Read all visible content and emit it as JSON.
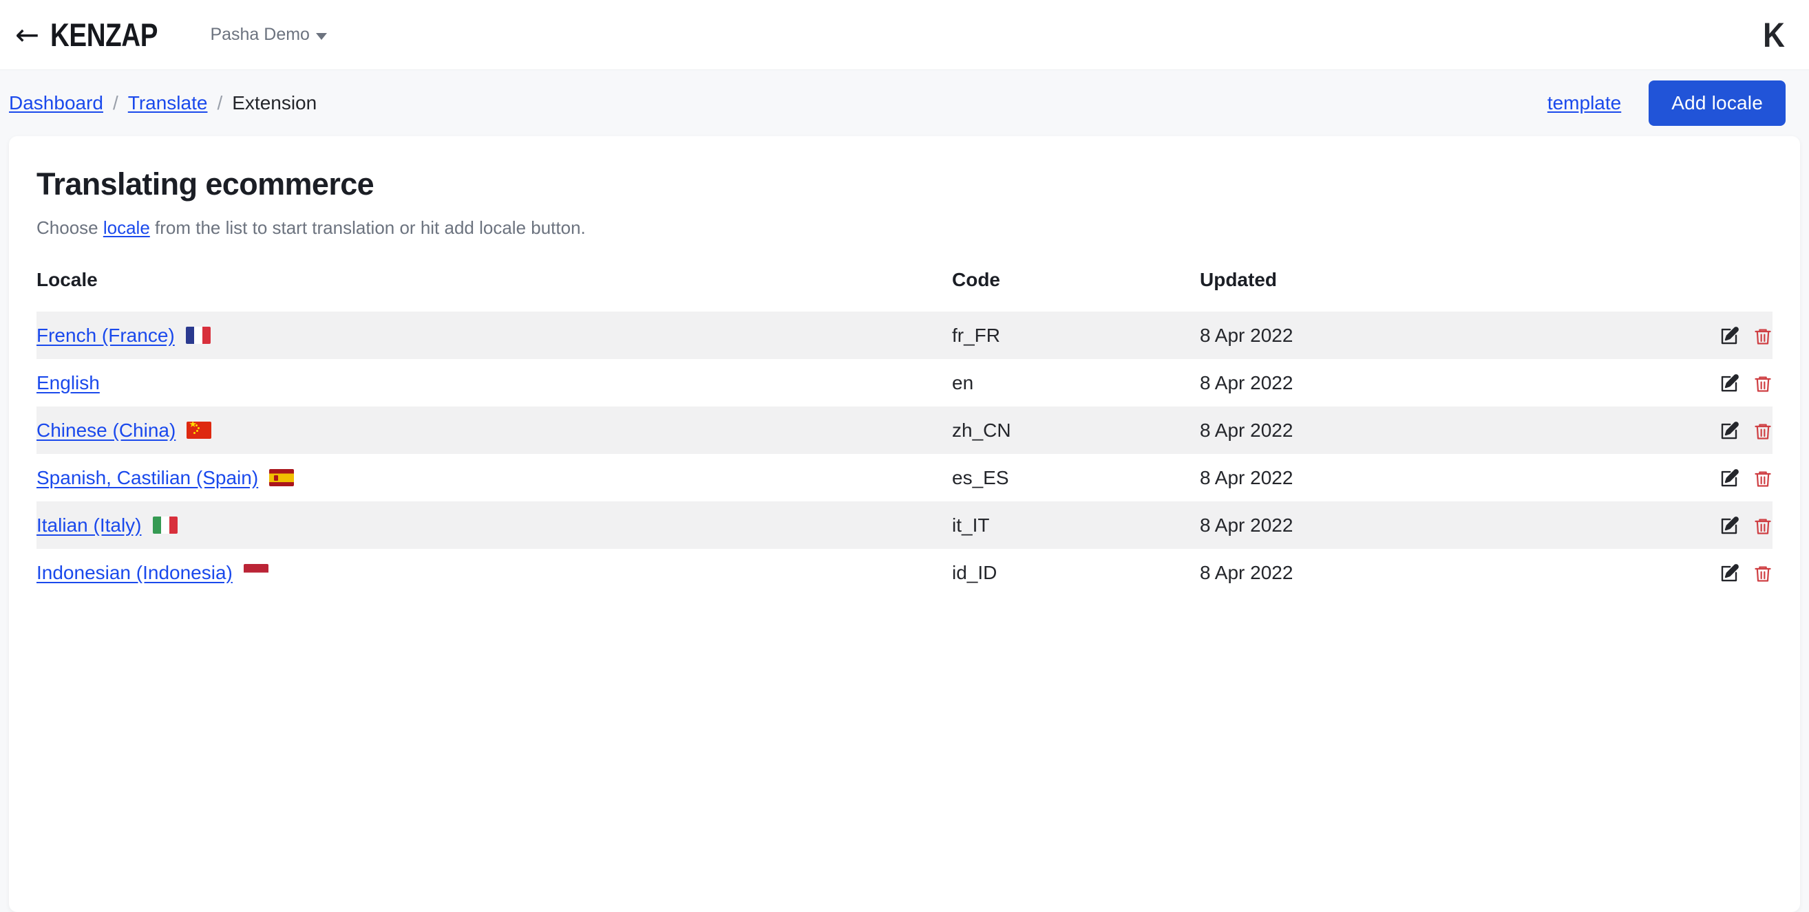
{
  "header": {
    "back_label": "←",
    "brand": "KENZAP",
    "site_selector": "Pasha Demo",
    "caret_icon": "chevron-down-icon",
    "avatar_letter": "K"
  },
  "breadcrumb": {
    "items": [
      {
        "label": "Dashboard",
        "link": true
      },
      {
        "label": "Translate",
        "link": true
      },
      {
        "label": "Extension",
        "link": false
      }
    ],
    "separator": "/",
    "template_link": "template",
    "add_locale_button": "Add locale"
  },
  "main": {
    "title": "Translating ecommerce",
    "subtitle_before": "Choose ",
    "subtitle_link": "locale",
    "subtitle_after": " from the list to start translation or hit add locale button.",
    "columns": {
      "locale": "Locale",
      "code": "Code",
      "updated": "Updated"
    },
    "rows": [
      {
        "locale": "French (France)",
        "flag": "flag-fr",
        "flag_name": "flag-france",
        "code": "fr_FR",
        "updated": "8 Apr 2022",
        "stripe": true
      },
      {
        "locale": "English",
        "flag": "",
        "flag_name": "",
        "code": "en",
        "updated": "8 Apr 2022",
        "stripe": false
      },
      {
        "locale": "Chinese (China)",
        "flag": "flag-cn",
        "flag_name": "flag-china",
        "code": "zh_CN",
        "updated": "8 Apr 2022",
        "stripe": true
      },
      {
        "locale": "Spanish, Castilian (Spain)",
        "flag": "flag-es",
        "flag_name": "flag-spain",
        "code": "es_ES",
        "updated": "8 Apr 2022",
        "stripe": false
      },
      {
        "locale": "Italian (Italy)",
        "flag": "flag-it",
        "flag_name": "flag-italy",
        "code": "it_IT",
        "updated": "8 Apr 2022",
        "stripe": true
      },
      {
        "locale": "Indonesian (Indonesia)",
        "flag": "flag-id",
        "flag_name": "flag-indonesia",
        "code": "id_ID",
        "updated": "8 Apr 2022",
        "stripe": false
      }
    ],
    "row_actions": {
      "edit_icon": "edit-pencil-icon",
      "delete_icon": "trash-delete-icon"
    }
  },
  "colors": {
    "accent_blue": "#2154d8",
    "link_blue": "#1a49ec",
    "delete_red": "#cf4044",
    "page_bg": "#f7f8fa",
    "row_stripe": "#f1f1f2"
  }
}
